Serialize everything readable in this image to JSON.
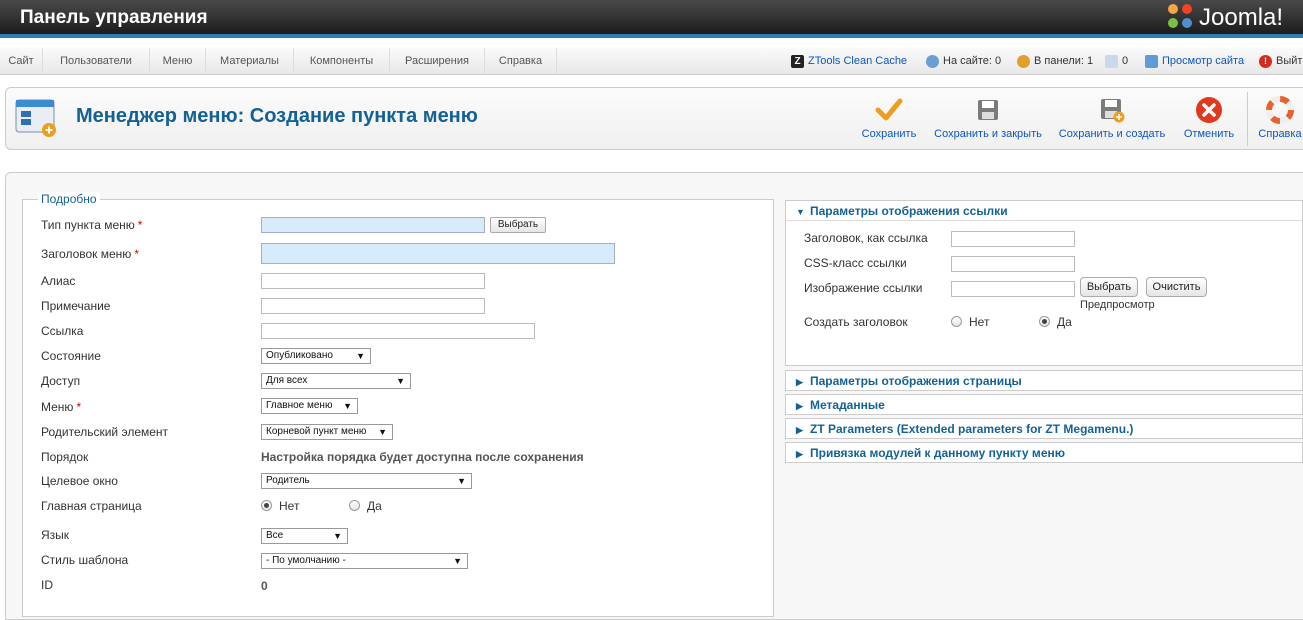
{
  "header": {
    "title": "Панель управления",
    "logo_text": "Joomla!"
  },
  "menu": {
    "items": [
      {
        "label": "Сайт"
      },
      {
        "label": "Пользователи"
      },
      {
        "label": "Меню"
      },
      {
        "label": "Материалы"
      },
      {
        "label": "Компоненты"
      },
      {
        "label": "Расширения"
      },
      {
        "label": "Справка"
      }
    ]
  },
  "status": {
    "cache": "ZTools Clean Cache",
    "on_site": "На сайте: 0",
    "in_panel": "В панели: 1",
    "messages": "0",
    "view_site": "Просмотр сайта",
    "logout": "Выйти"
  },
  "toolbar": {
    "title": "Менеджер меню: Создание пункта меню",
    "save": "Сохранить",
    "save_close": "Сохранить и закрыть",
    "save_new": "Сохранить и создать",
    "cancel": "Отменить",
    "help": "Справка"
  },
  "details": {
    "legend": "Подробно",
    "type_label": "Тип пункта меню",
    "select_button": "Выбрать",
    "title_label": "Заголовок меню",
    "alias_label": "Алиас",
    "note_label": "Примечание",
    "link_label": "Ссылка",
    "state_label": "Состояние",
    "state_value": "Опубликовано",
    "access_label": "Доступ",
    "access_value": "Для всех",
    "menu_label": "Меню",
    "menu_value": "Главное меню",
    "parent_label": "Родительский элемент",
    "parent_value": "Корневой пункт меню",
    "order_label": "Порядок",
    "order_value": "Настройка порядка будет доступна после сохранения",
    "target_label": "Целевое окно",
    "target_value": "Родитель",
    "home_label": "Главная страница",
    "home_no": "Нет",
    "home_yes": "Да",
    "home_selected": "Нет",
    "language_label": "Язык",
    "language_value": "Все",
    "template_label": "Стиль шаблона",
    "template_value": "- По умолчанию -",
    "id_label": "ID",
    "id_value": "0"
  },
  "link_options": {
    "header": "Параметры отображения ссылки",
    "title_attr_label": "Заголовок, как ссылка",
    "css_label": "CSS-класс ссылки",
    "image_label": "Изображение ссылки",
    "select_button": "Выбрать",
    "clear_button": "Очистить",
    "preview": "Предпросмотр",
    "create_title_label": "Создать заголовок",
    "no": "Нет",
    "yes": "Да",
    "selected": "Да"
  },
  "collapsed_panes": [
    "Параметры отображения страницы",
    "Метаданные",
    "ZT Parameters (Extended parameters for ZT Megamenu.)",
    "Привязка модулей к данному пункту меню"
  ],
  "colors": {
    "accent": "#146295",
    "link": "#0b55c4",
    "required": "#cc0000",
    "highlight_field": "#d7ebfa"
  }
}
